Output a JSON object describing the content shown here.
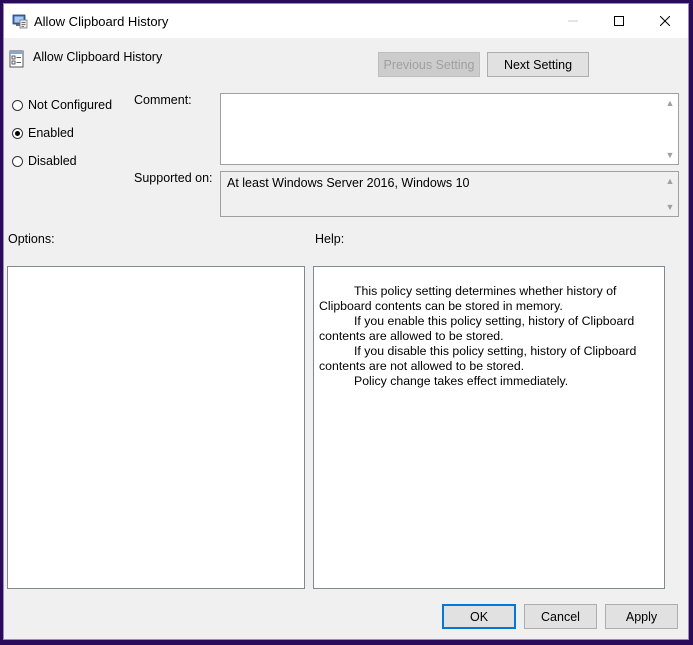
{
  "window": {
    "title": "Allow Clipboard History"
  },
  "header": {
    "setting_title": "Allow Clipboard History",
    "previous_label": "Previous Setting",
    "next_label": "Next Setting"
  },
  "state": {
    "options": [
      {
        "label": "Not Configured",
        "checked": false
      },
      {
        "label": "Enabled",
        "checked": true
      },
      {
        "label": "Disabled",
        "checked": false
      }
    ]
  },
  "comment": {
    "label": "Comment:",
    "value": ""
  },
  "supported": {
    "label": "Supported on:",
    "value": "At least Windows Server 2016, Windows 10"
  },
  "options_panel": {
    "label": "Options:"
  },
  "help_panel": {
    "label": "Help:",
    "lines": [
      "This policy setting determines whether history of",
      "Clipboard contents can be stored in memory.",
      "If you enable this policy setting, history of Clipboard",
      "contents are allowed to be stored.",
      "If you disable this policy setting, history of Clipboard",
      "contents are not allowed to be stored.",
      "Policy change takes effect immediately."
    ]
  },
  "footer": {
    "ok_label": "OK",
    "cancel_label": "Cancel",
    "apply_label": "Apply"
  }
}
